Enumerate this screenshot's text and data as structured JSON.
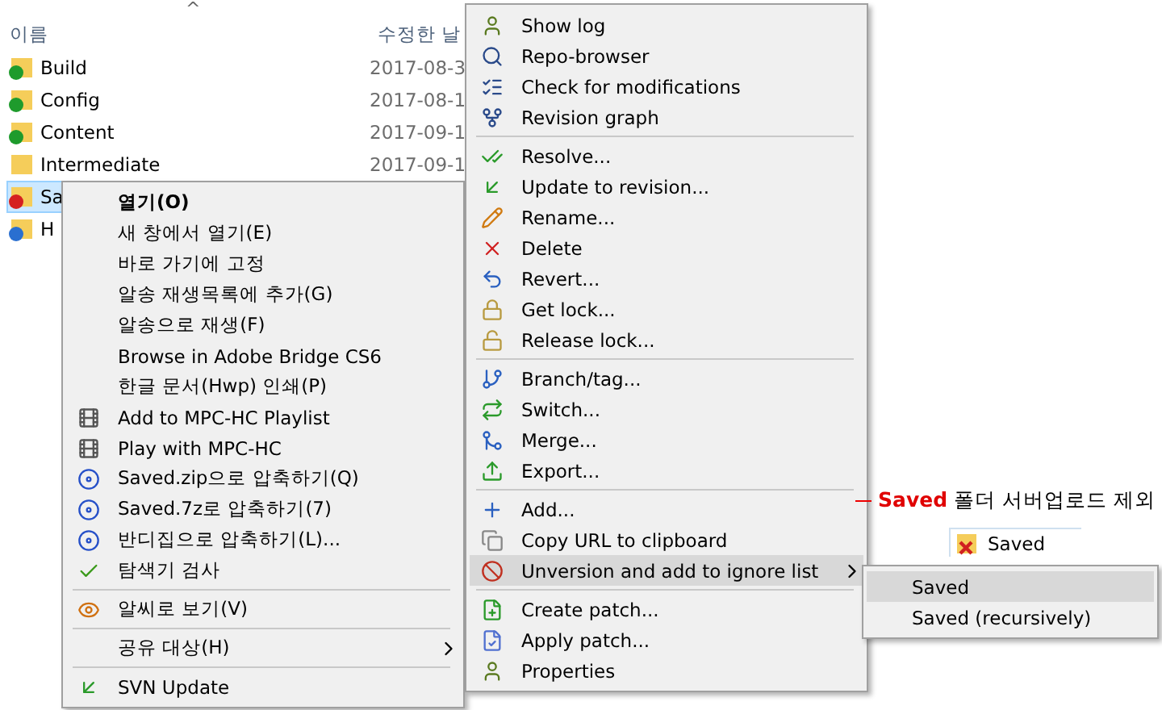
{
  "explorer": {
    "sort_caret": "^",
    "columns": [
      "이름",
      "수정한 날"
    ],
    "rows": [
      {
        "name": "Build",
        "date": "2017-08-3",
        "kind": "ok",
        "selected": false
      },
      {
        "name": "Config",
        "date": "2017-08-1",
        "kind": "ok",
        "selected": false
      },
      {
        "name": "Content",
        "date": "2017-09-1",
        "kind": "ok",
        "selected": false
      },
      {
        "name": "Intermediate",
        "date": "2017-09-1",
        "kind": "plain",
        "selected": false
      },
      {
        "name": "Sa",
        "kind": "conflict",
        "selected": true
      },
      {
        "name": "H",
        "kind": "modified",
        "selected": false
      }
    ]
  },
  "context_menu": {
    "items": [
      {
        "kind": "item",
        "label": "열기(O)",
        "default": true,
        "submenu": false
      },
      {
        "kind": "item",
        "label": "새 창에서 열기(E)",
        "default": false,
        "submenu": false
      },
      {
        "kind": "item",
        "label": "바로 가기에 고정",
        "default": false,
        "submenu": false
      },
      {
        "kind": "item",
        "label": "알송 재생목록에 추가(G)",
        "default": false,
        "submenu": false
      },
      {
        "kind": "item",
        "label": "알송으로 재생(F)",
        "default": false,
        "submenu": false
      },
      {
        "kind": "item",
        "label": "Browse in Adobe Bridge CS6",
        "default": false,
        "submenu": false
      },
      {
        "kind": "item",
        "label": "한글 문서(Hwp) 인쇄(P)",
        "default": false,
        "submenu": false
      },
      {
        "kind": "item",
        "label": "Add to MPC-HC Playlist",
        "default": false,
        "submenu": false
      },
      {
        "kind": "item",
        "label": "Play with MPC-HC",
        "default": false,
        "submenu": false
      },
      {
        "kind": "item",
        "label": "Saved.zip으로 압축하기(Q)",
        "default": false,
        "submenu": false
      },
      {
        "kind": "item",
        "label": "Saved.7z로 압축하기(7)",
        "default": false,
        "submenu": false
      },
      {
        "kind": "item",
        "label": "반디집으로 압축하기(L)...",
        "default": false,
        "submenu": false
      },
      {
        "kind": "item",
        "label": "탐색기 검사",
        "default": false,
        "submenu": false
      },
      {
        "kind": "separator"
      },
      {
        "kind": "item",
        "label": "알씨로 보기(V)",
        "default": false,
        "submenu": false
      },
      {
        "kind": "separator"
      },
      {
        "kind": "item",
        "label": "공유 대상(H)",
        "default": false,
        "submenu": true
      },
      {
        "kind": "separator"
      },
      {
        "kind": "item",
        "label": "SVN Update",
        "default": false,
        "submenu": false
      }
    ]
  },
  "svn_menu": {
    "items": [
      {
        "kind": "item",
        "label": "Show log",
        "selected": false,
        "submenu": false
      },
      {
        "kind": "item",
        "label": "Repo-browser",
        "selected": false,
        "submenu": false
      },
      {
        "kind": "item",
        "label": "Check for modifications",
        "selected": false,
        "submenu": false
      },
      {
        "kind": "item",
        "label": "Revision graph",
        "selected": false,
        "submenu": false
      },
      {
        "kind": "separator"
      },
      {
        "kind": "item",
        "label": "Resolve...",
        "selected": false,
        "submenu": false
      },
      {
        "kind": "item",
        "label": "Update to revision...",
        "selected": false,
        "submenu": false
      },
      {
        "kind": "item",
        "label": "Rename...",
        "selected": false,
        "submenu": false
      },
      {
        "kind": "item",
        "label": "Delete",
        "selected": false,
        "submenu": false
      },
      {
        "kind": "item",
        "label": "Revert...",
        "selected": false,
        "submenu": false
      },
      {
        "kind": "item",
        "label": "Get lock...",
        "selected": false,
        "submenu": false
      },
      {
        "kind": "item",
        "label": "Release lock...",
        "selected": false,
        "submenu": false
      },
      {
        "kind": "separator"
      },
      {
        "kind": "item",
        "label": "Branch/tag...",
        "selected": false,
        "submenu": false
      },
      {
        "kind": "item",
        "label": "Switch...",
        "selected": false,
        "submenu": false
      },
      {
        "kind": "item",
        "label": "Merge...",
        "selected": false,
        "submenu": false
      },
      {
        "kind": "item",
        "label": "Export...",
        "selected": false,
        "submenu": false
      },
      {
        "kind": "separator"
      },
      {
        "kind": "item",
        "label": "Add...",
        "selected": false,
        "submenu": false
      },
      {
        "kind": "item",
        "label": "Copy URL to clipboard",
        "selected": false,
        "submenu": false
      },
      {
        "kind": "item",
        "label": "Unversion and add to ignore list",
        "selected": true,
        "submenu": true
      },
      {
        "kind": "separator"
      },
      {
        "kind": "item",
        "label": "Create patch...",
        "selected": false,
        "submenu": false
      },
      {
        "kind": "item",
        "label": "Apply patch...",
        "selected": false,
        "submenu": false
      },
      {
        "kind": "item",
        "label": "Properties",
        "selected": false,
        "submenu": false
      }
    ]
  },
  "submenu": {
    "items": [
      {
        "label": "Saved",
        "selected": true
      },
      {
        "label": "Saved (recursively)",
        "selected": false
      }
    ]
  },
  "annotation": {
    "text": "**Saved** 폴더 서버업로드 제외",
    "chip": "Saved"
  }
}
